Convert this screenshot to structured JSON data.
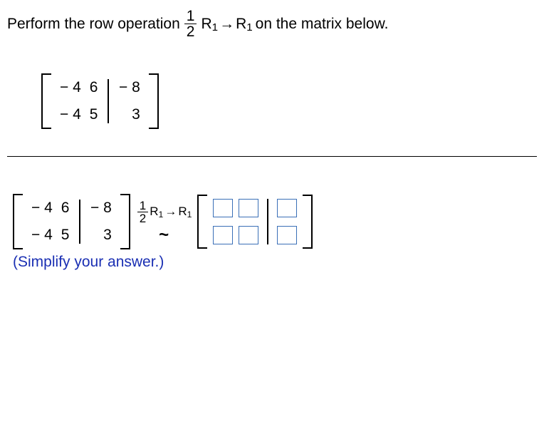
{
  "question": {
    "pre": "Perform the row operation",
    "frac_num": "1",
    "frac_den": "2",
    "r_from": "R",
    "r_from_sub": "1",
    "arrow": "→",
    "r_to": "R",
    "r_to_sub": "1",
    "post": "on the matrix below."
  },
  "matrix": {
    "r1c1": "− 4",
    "r1c2": "6",
    "r1c3": "− 8",
    "r2c1": "− 4",
    "r2c2": "5",
    "r2c3": "3"
  },
  "answer": {
    "op_frac_num": "1",
    "op_frac_den": "2",
    "op_r_from": "R",
    "op_r_from_sub": "1",
    "op_arrow": "→",
    "op_r_to": "R",
    "op_r_to_sub": "1",
    "tilde": "~",
    "simplify": "(Simplify your answer.)"
  }
}
